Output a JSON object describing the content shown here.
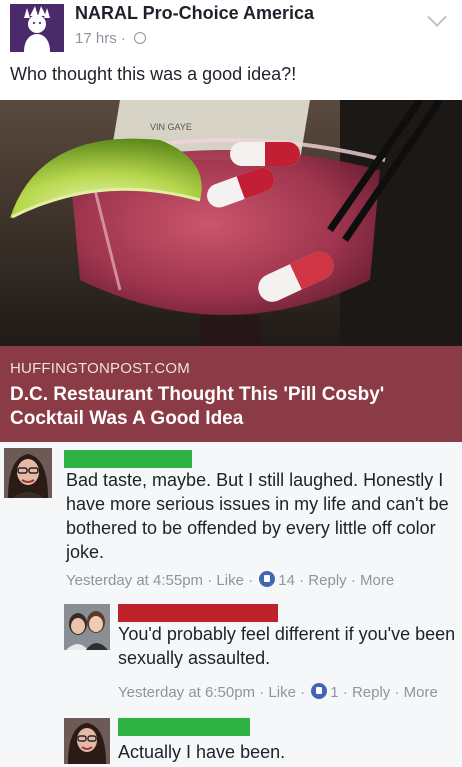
{
  "post": {
    "page_name": "NARAL Pro-Choice America",
    "time": "17 hrs",
    "separator": " · ",
    "text": "Who thought this was a good idea?!"
  },
  "link": {
    "domain": "HUFFINGTONPOST.COM",
    "title": "D.C. Restaurant Thought This 'Pill Cosby' Cocktail Was A Good Idea",
    "image_sign_text": "VIN GAYE"
  },
  "comments": [
    {
      "name_redaction_color": "#2fb344",
      "text": "Bad taste, maybe. But I still laughed. Honestly I have more serious issues in my life and can't be bothered to be offended by every little off color joke.",
      "time": "Yesterday at 4:55pm",
      "like": "Like",
      "like_count": "14",
      "reply": "Reply",
      "more": "More"
    },
    {
      "name_redaction_color": "#c0222c",
      "text": "You'd probably feel different if you've been sexually assaulted.",
      "time": "Yesterday at 6:50pm",
      "like": "Like",
      "like_count": "1",
      "reply": "Reply",
      "more": "More"
    },
    {
      "name_redaction_color": "#2fb344",
      "text": "Actually I have been."
    }
  ],
  "colors": {
    "caption_bg": "#8b3b45",
    "facebook_blue": "#4267b2",
    "meta_grey": "#90949c"
  }
}
